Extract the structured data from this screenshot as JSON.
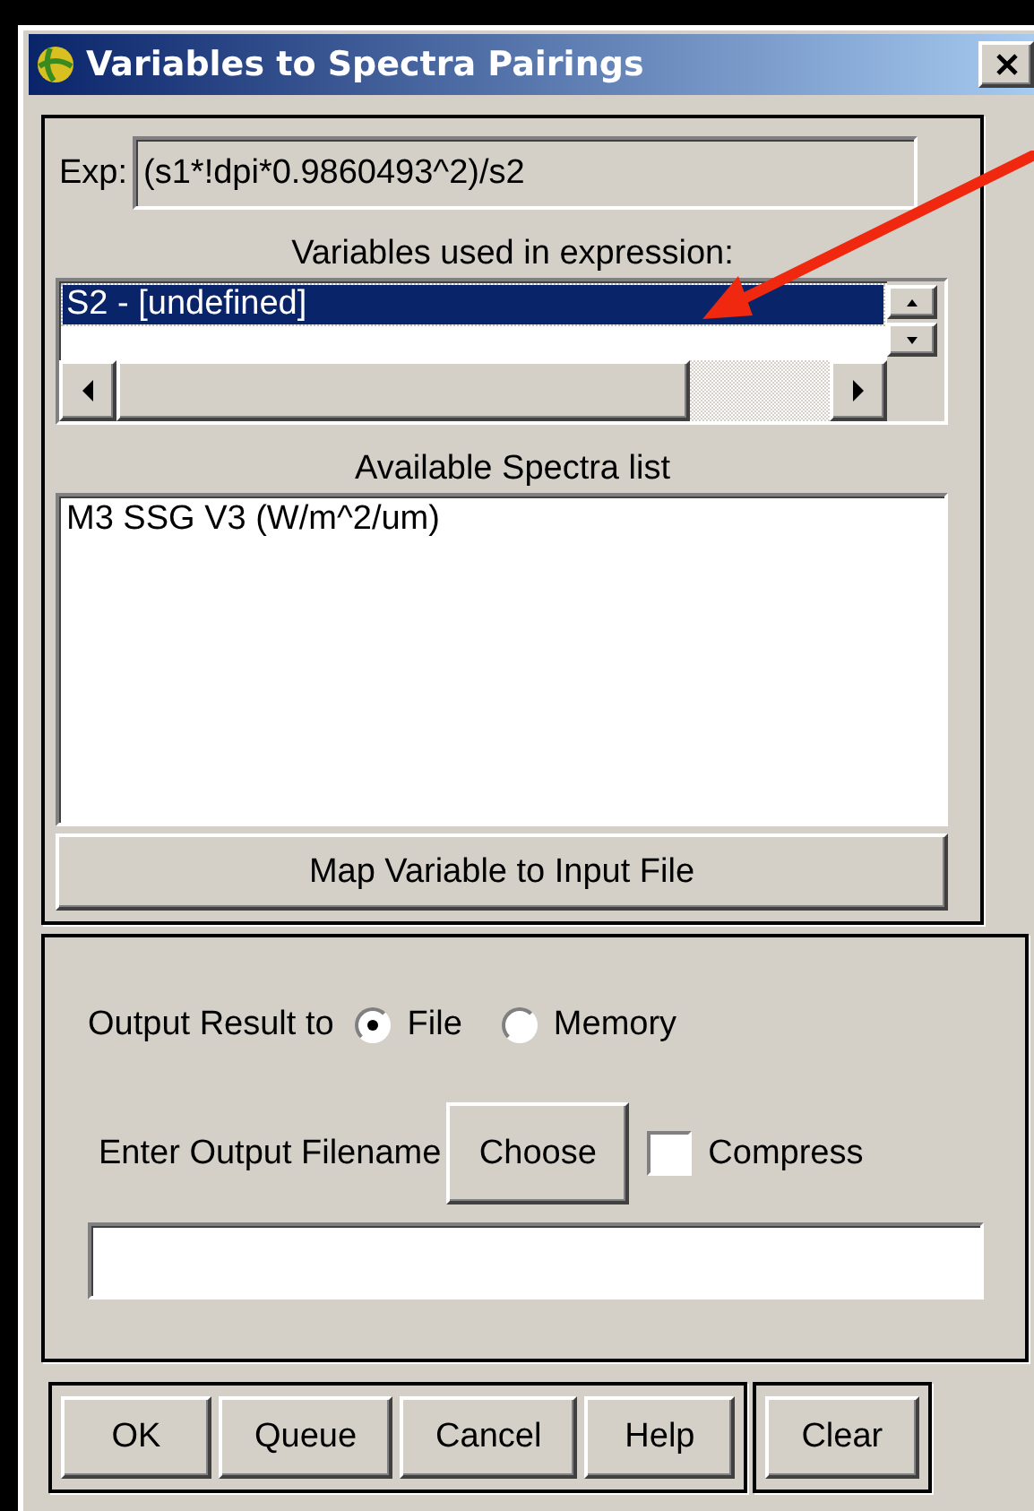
{
  "window": {
    "title": "Variables to Spectra Pairings"
  },
  "expression": {
    "label": "Exp:",
    "value": "(s1*!dpi*0.9860493^2)/s2"
  },
  "variables": {
    "label": "Variables used in expression:",
    "items": [
      {
        "text": "S2 - [undefined]",
        "selected": true
      }
    ]
  },
  "spectra": {
    "label": "Available Spectra list",
    "items": [
      {
        "text": "M3 SSG V3 (W/m^2/um)",
        "selected": false
      }
    ]
  },
  "map_button": "Map Variable to Input File",
  "output": {
    "label": "Output Result to",
    "options": [
      {
        "label": "File",
        "selected": true
      },
      {
        "label": "Memory",
        "selected": false
      }
    ]
  },
  "filename": {
    "label": "Enter Output Filename",
    "choose_button": "Choose",
    "compress": {
      "label": "Compress",
      "checked": false
    }
  },
  "buttons": [
    "OK",
    "Queue",
    "Cancel",
    "Help"
  ],
  "extra_buttons": [
    "Clear"
  ]
}
